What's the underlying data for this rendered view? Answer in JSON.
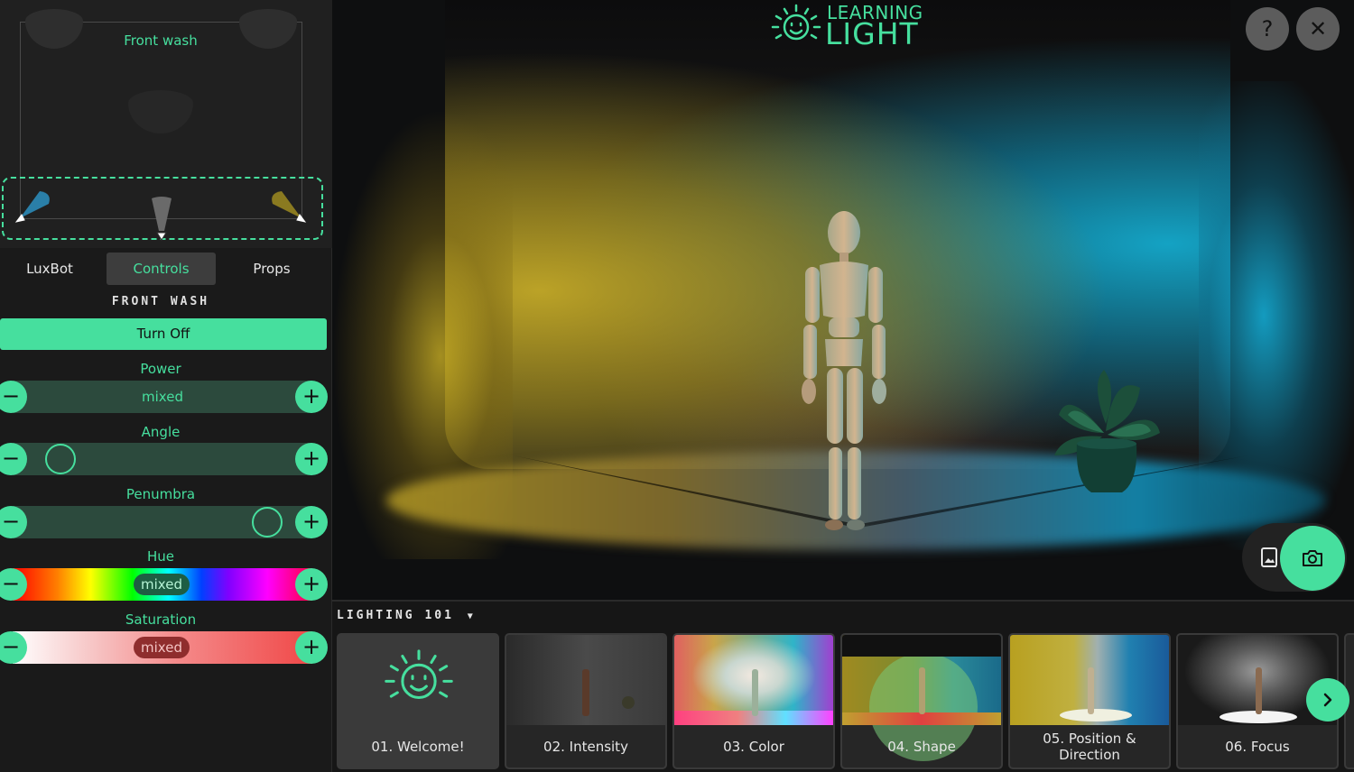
{
  "app": {
    "logo_line1": "LEARNING",
    "logo_line2": "LIGHT",
    "accent_color": "#46df9e"
  },
  "lights_map": {
    "selected_group_label": "Front wash",
    "spot_colors": [
      "#2a7fa8",
      "#6a6a6a",
      "#8a7a20"
    ]
  },
  "tabs": [
    {
      "label": "LuxBot",
      "active": false
    },
    {
      "label": "Controls",
      "active": true
    },
    {
      "label": "Props",
      "active": false
    }
  ],
  "controls": {
    "section_title": "FRONT WASH",
    "turn_off_label": "Turn Off",
    "power": {
      "label": "Power",
      "value": "mixed"
    },
    "angle": {
      "label": "Angle",
      "level": 0.12
    },
    "penumbra": {
      "label": "Penumbra",
      "level": 0.89
    },
    "hue": {
      "label": "Hue",
      "value": "mixed"
    },
    "saturation": {
      "label": "Saturation",
      "value": "mixed"
    }
  },
  "header_buttons": {
    "help_label": "?",
    "close_label": "✕"
  },
  "icons": {
    "help": "question-icon",
    "close": "close-icon",
    "gallery": "image-book-icon",
    "camera": "camera-icon",
    "next": "chevron-right-icon",
    "dropdown": "caret-down-icon"
  },
  "course": {
    "title": "LIGHTING 101",
    "lessons": [
      {
        "label": "01. Welcome!",
        "active": true
      },
      {
        "label": "02. Intensity",
        "active": false
      },
      {
        "label": "03. Color",
        "active": false
      },
      {
        "label": "04. Shape",
        "active": false
      },
      {
        "label": "05. Position & Direction",
        "active": false
      },
      {
        "label": "06. Focus",
        "active": false
      }
    ]
  }
}
